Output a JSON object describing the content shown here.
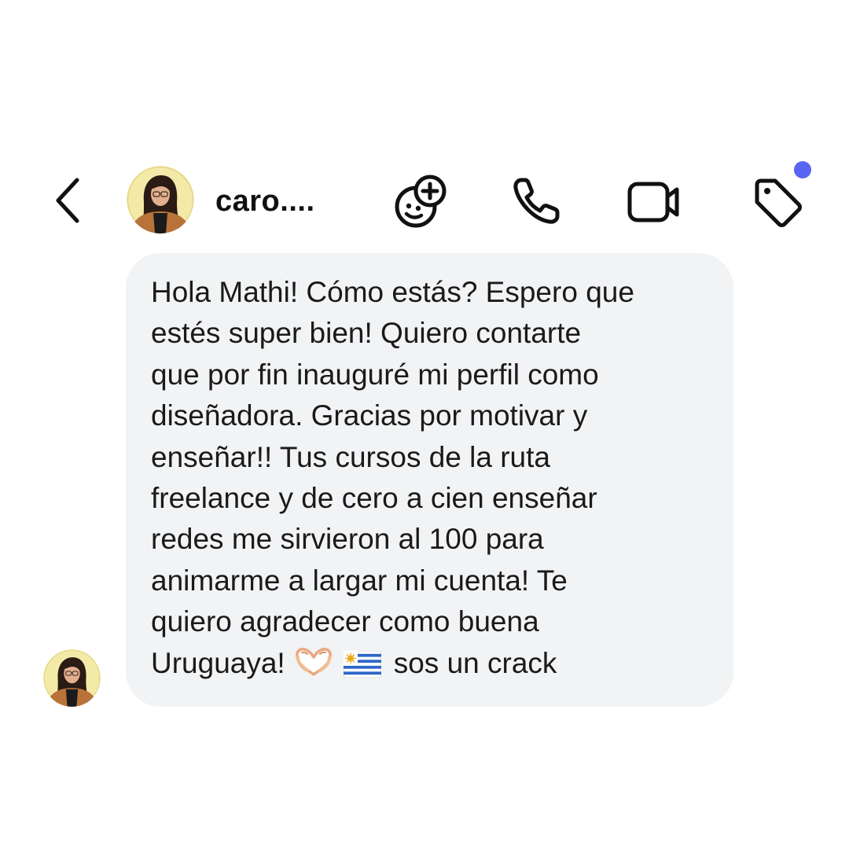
{
  "header": {
    "contact_name": "caro....",
    "avatar_icon": "profile-photo",
    "icons": {
      "back": "chevron-left-icon",
      "effects": "sticker-effects-icon",
      "call": "phone-icon",
      "video": "video-camera-icon",
      "tag": "tag-icon"
    },
    "notification_dot_color": "#5865F2"
  },
  "conversation": {
    "messages": [
      {
        "sender": "caro....",
        "lines": [
          "Hola Mathi! Cómo estás? Espero que",
          "estés super bien! Quiero contarte",
          "que por fin inauguré mi perfil como",
          "diseñadora. Gracias por motivar y",
          "enseñar!! Tus cursos de la ruta",
          "freelance y de cero a cien enseñar",
          "redes me sirvieron al 100 para",
          "animarme a largar mi cuenta! Te",
          "quiero agradecer como buena"
        ],
        "last_line_start": "Uruguaya!",
        "emojis": [
          "heart-hands-emoji",
          "uruguay-flag-emoji"
        ],
        "last_line_end": "sos un crack"
      }
    ]
  },
  "colors": {
    "bubble_background": "#F2F3F5",
    "text": "#1A1A1A",
    "icon_stroke": "#111111"
  }
}
